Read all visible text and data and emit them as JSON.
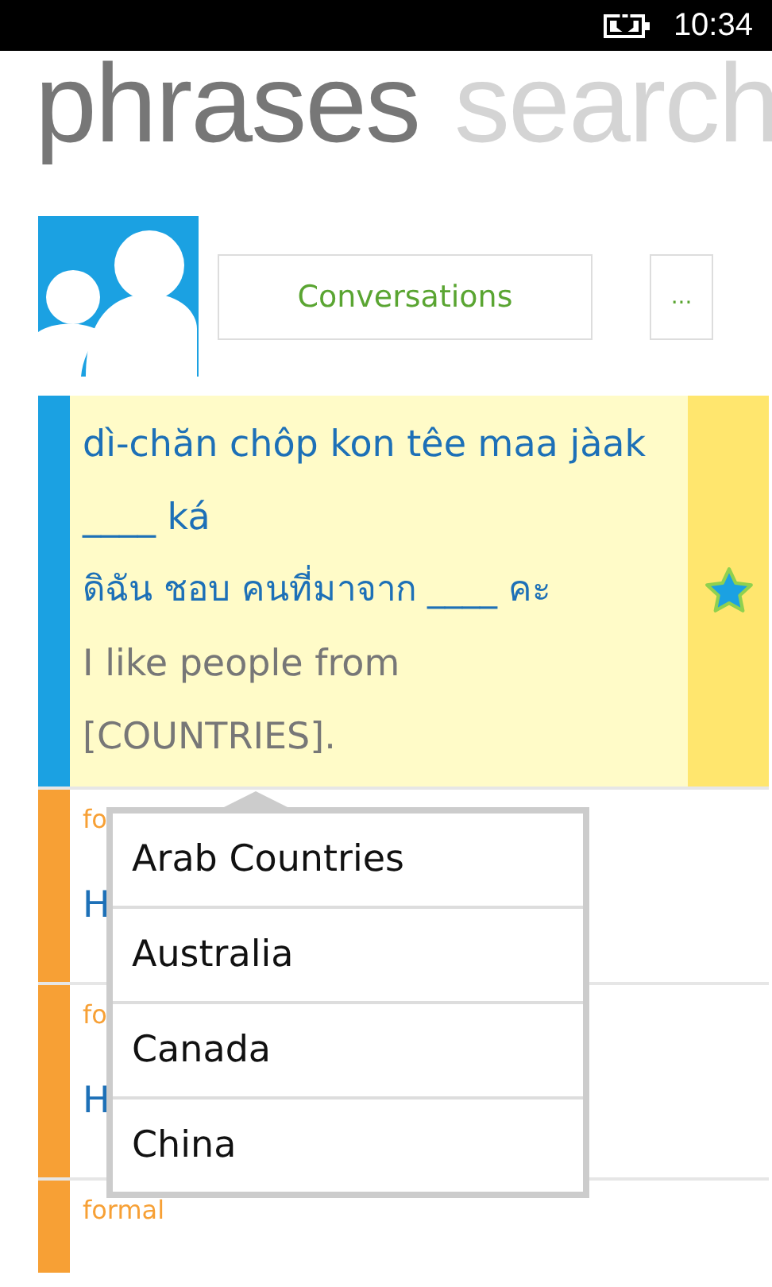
{
  "status_bar": {
    "time": "10:34"
  },
  "pivot": [
    {
      "label": "phrases",
      "selected": true
    },
    {
      "label": "search",
      "selected": false
    }
  ],
  "header": {
    "category_button": "Conversations",
    "more_button": "..."
  },
  "phrases": [
    {
      "kind": "full",
      "color": "#1ba1e2",
      "selected": true,
      "favorite": true,
      "transliteration": "dì-chăn chôp kon têe maa jàak ____ ká",
      "thai": "ดิฉัน ชอบ คนที่มาจาก ____ คะ",
      "english": "I like people from [COUNTRIES]."
    },
    {
      "kind": "partial",
      "color": "#f7a035",
      "selected": false,
      "favorite": false,
      "tag": "fo",
      "text": "H"
    },
    {
      "kind": "partial",
      "color": "#f7a035",
      "selected": false,
      "favorite": false,
      "tag": "fo",
      "text": "H"
    },
    {
      "kind": "partial",
      "color": "#f7a035",
      "selected": false,
      "favorite": false,
      "tag": "formal"
    }
  ],
  "popup": {
    "items": [
      "Arab Countries",
      "Australia",
      "Canada",
      "China"
    ]
  }
}
